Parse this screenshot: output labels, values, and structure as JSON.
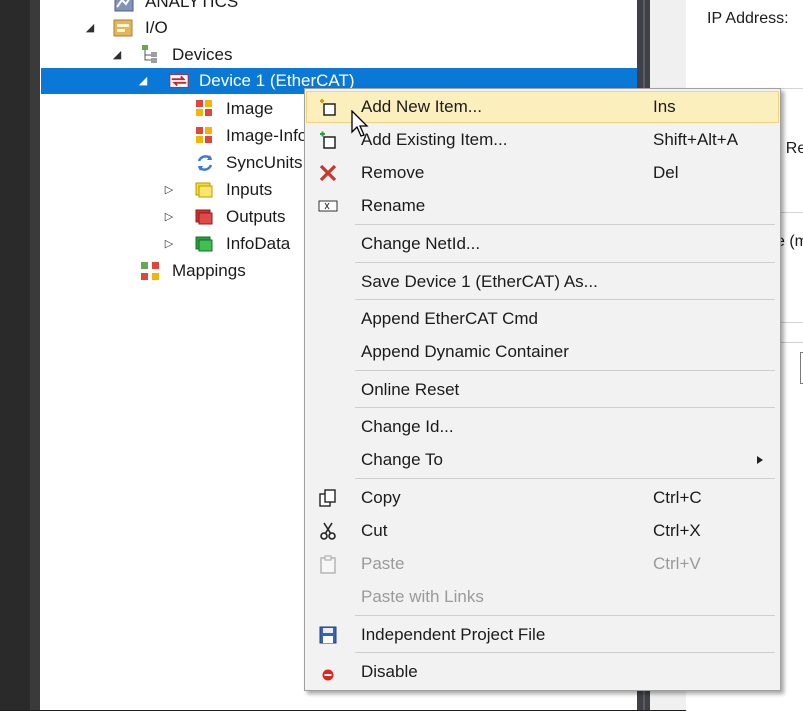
{
  "tree": {
    "items": [
      {
        "label": "ANALYTICS"
      },
      {
        "label": "I/O"
      },
      {
        "label": "Devices"
      },
      {
        "label": "Device 1 (EtherCAT)"
      },
      {
        "label": "Image"
      },
      {
        "label": "Image-Info"
      },
      {
        "label": "SyncUnits"
      },
      {
        "label": "Inputs"
      },
      {
        "label": "Outputs"
      },
      {
        "label": "InfoData"
      },
      {
        "label": "Mappings"
      }
    ]
  },
  "right_panel": {
    "ip_label": "IP Address:",
    "frag1": "r Re",
    "frag2": "e (m"
  },
  "context_menu": {
    "items": [
      {
        "label": "Add New Item...",
        "shortcut": "Ins",
        "icon": "add-new-item-icon"
      },
      {
        "label": "Add Existing Item...",
        "shortcut": "Shift+Alt+A",
        "icon": "add-existing-item-icon"
      },
      {
        "label": "Remove",
        "shortcut": "Del",
        "icon": "remove-x-icon"
      },
      {
        "label": "Rename",
        "shortcut": "",
        "icon": "rename-icon"
      },
      {
        "label": "Change NetId...",
        "shortcut": ""
      },
      {
        "label": "Save Device 1 (EtherCAT) As...",
        "shortcut": ""
      },
      {
        "label": "Append EtherCAT Cmd",
        "shortcut": ""
      },
      {
        "label": "Append Dynamic Container",
        "shortcut": ""
      },
      {
        "label": "Online Reset",
        "shortcut": ""
      },
      {
        "label": "Change Id...",
        "shortcut": ""
      },
      {
        "label": "Change To",
        "shortcut": "",
        "submenu": true
      },
      {
        "label": "Copy",
        "shortcut": "Ctrl+C",
        "icon": "copy-icon"
      },
      {
        "label": "Cut",
        "shortcut": "Ctrl+X",
        "icon": "scissors-icon"
      },
      {
        "label": "Paste",
        "shortcut": "Ctrl+V",
        "icon": "paste-icon",
        "disabled": true
      },
      {
        "label": "Paste with Links",
        "shortcut": "",
        "disabled": true
      },
      {
        "label": "Independent Project File",
        "shortcut": "",
        "icon": "save-disk-icon"
      },
      {
        "label": "Disable",
        "shortcut": "",
        "icon": "disable-icon"
      }
    ]
  }
}
